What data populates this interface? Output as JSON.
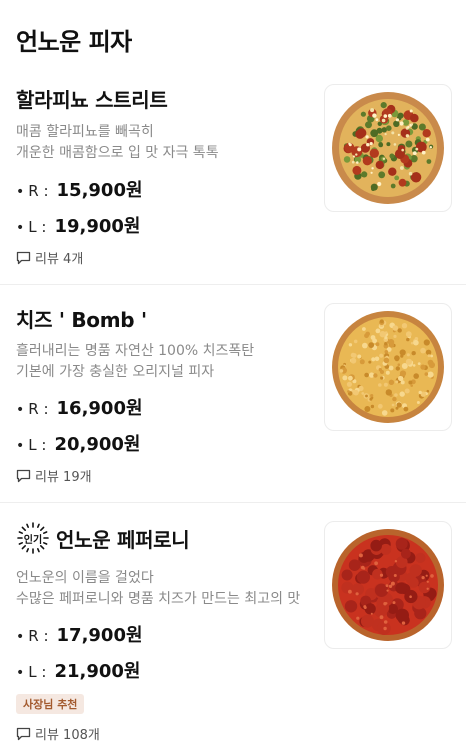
{
  "header": {
    "title": "언노운 피자"
  },
  "menu": [
    {
      "name": "할라피뇨 스트리트",
      "desc": [
        "매콤 할라피뇨를 빼곡히",
        "개운한 매콤함으로 입 맛 자극 톡톡"
      ],
      "prices": [
        {
          "bullet": "•",
          "size": "R :",
          "amount": "15,900원"
        },
        {
          "bullet": "•",
          "size": "L :",
          "amount": "19,900원"
        }
      ],
      "review": "리뷰 4개",
      "image": "jalapeno-pizza-image"
    },
    {
      "name": "치즈 ' Bomb '",
      "desc": [
        "흘러내리는 명품 자연산 100% 치즈폭탄",
        "기본에 가장 충실한 오리지널 피자"
      ],
      "prices": [
        {
          "bullet": "•",
          "size": "R :",
          "amount": "16,900원"
        },
        {
          "bullet": "•",
          "size": "L :",
          "amount": "20,900원"
        }
      ],
      "review": "리뷰 19개",
      "image": "cheese-pizza-image"
    },
    {
      "popular_label": "인기",
      "name": "언노운 페퍼로니",
      "desc": [
        "언노운의 이름을 걸었다",
        "수많은 페퍼로니와 명품 치즈가 만드는 최고의 맛"
      ],
      "prices": [
        {
          "bullet": "•",
          "size": "R :",
          "amount": "17,900원"
        },
        {
          "bullet": "•",
          "size": "L :",
          "amount": "21,900원"
        }
      ],
      "badge": "사장님 추천",
      "review": "리뷰 108개",
      "image": "pepperoni-pizza-image"
    }
  ],
  "colors": {
    "badge_bg": "#f5e8e1",
    "badge_text": "#a35a2e",
    "desc_text": "#8a8a8a"
  }
}
